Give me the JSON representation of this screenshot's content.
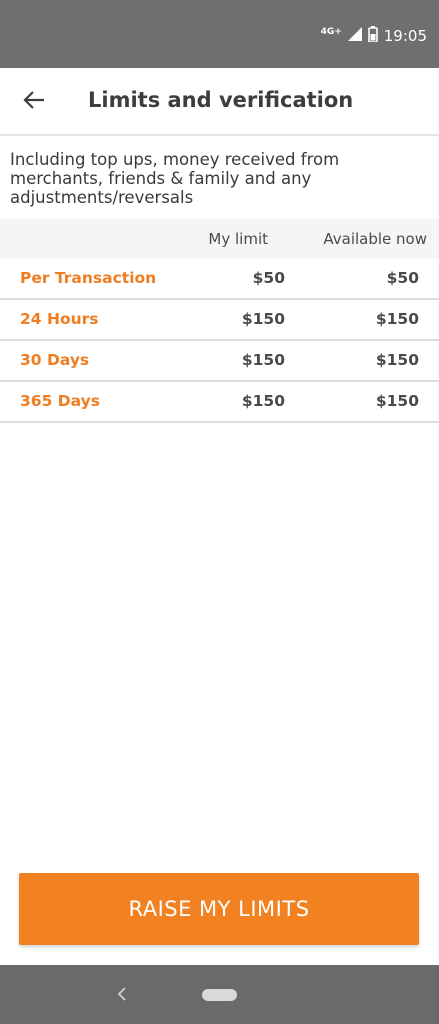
{
  "status_bar": {
    "network": "4G+",
    "time": "19:05"
  },
  "header": {
    "title": "Limits and verification"
  },
  "note": "Including top ups, money received from merchants, friends & family and any adjustments/reversals",
  "table": {
    "columns": [
      "My limit",
      "Available now"
    ],
    "rows": [
      {
        "label": "Per Transaction",
        "my_limit": "$50",
        "available": "$50"
      },
      {
        "label": "24 Hours",
        "my_limit": "$150",
        "available": "$150"
      },
      {
        "label": "30 Days",
        "my_limit": "$150",
        "available": "$150"
      },
      {
        "label": "365 Days",
        "my_limit": "$150",
        "available": "$150"
      }
    ]
  },
  "action": {
    "label": "RAISE MY LIMITS"
  },
  "colors": {
    "accent": "#f28122",
    "label_orange": "#ef7d22",
    "status_bar": "#6f6f6f",
    "nav_bar": "#6a6a6a"
  },
  "icons": {
    "back": "arrow-left-icon",
    "signal": "signal-icon",
    "battery": "battery-icon",
    "nav_back": "chevron-left-icon",
    "nav_home": "home-pill-icon"
  }
}
